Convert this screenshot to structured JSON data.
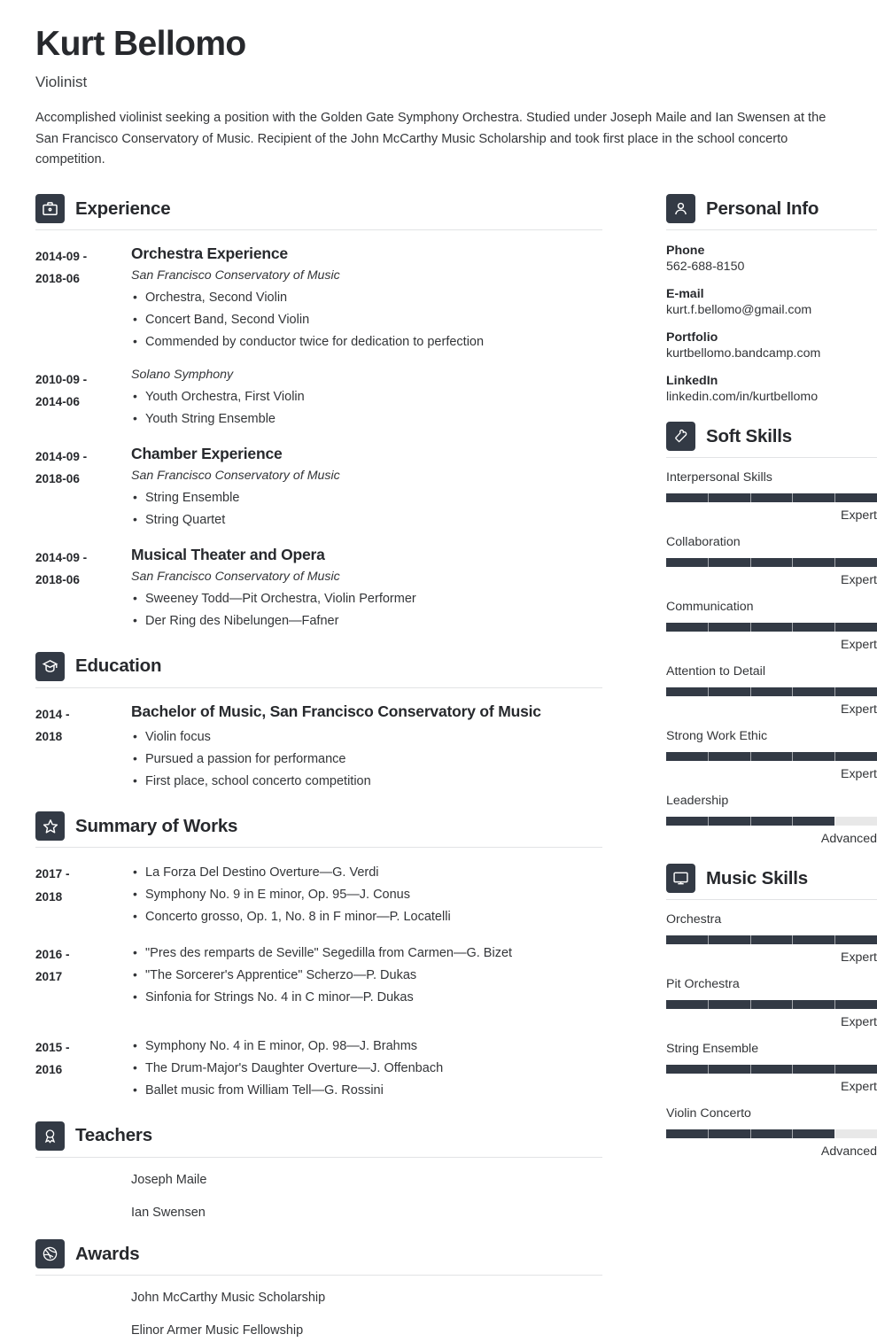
{
  "header": {
    "name": "Kurt Bellomo",
    "job_title": "Violinist",
    "summary": "Accomplished violinist seeking a position with the Golden Gate Symphony Orchestra. Studied under Joseph Maile and Ian Swensen at the San Francisco Conservatory of Music. Recipient of the John McCarthy Music Scholarship and took first place in the school concerto competition."
  },
  "theme": {
    "accent_dark": "#333a45",
    "text": "#333538",
    "heading": "#27292d",
    "rule": "#e2e3e5",
    "bar_track": "#e8e8e8"
  },
  "sections": {
    "experience": {
      "title": "Experience",
      "icon": "briefcase-icon",
      "entries": [
        {
          "date_from": "2014-09 -",
          "date_to": "2018-06",
          "title": "Orchestra Experience",
          "subtitle": "San Francisco Conservatory of Music",
          "bullets": [
            "Orchestra, Second Violin",
            "Concert Band, Second Violin",
            "Commended by conductor twice for dedication to perfection"
          ]
        },
        {
          "date_from": "2010-09 -",
          "date_to": "2014-06",
          "title": "",
          "subtitle": "Solano Symphony",
          "bullets": [
            "Youth Orchestra, First Violin",
            "Youth String Ensemble"
          ]
        },
        {
          "date_from": "2014-09 -",
          "date_to": "2018-06",
          "title": "Chamber Experience",
          "subtitle": "San Francisco Conservatory of Music",
          "bullets": [
            "String Ensemble",
            "String Quartet"
          ]
        },
        {
          "date_from": "2014-09 -",
          "date_to": "2018-06",
          "title": "Musical Theater and Opera",
          "subtitle": "San Francisco Conservatory of Music",
          "bullets": [
            "Sweeney Todd—Pit Orchestra, Violin Performer",
            "Der Ring des Nibelungen—Fafner"
          ]
        }
      ]
    },
    "education": {
      "title": "Education",
      "icon": "graduation-cap-icon",
      "entries": [
        {
          "date_from": "2014 -",
          "date_to": "2018",
          "title": "Bachelor of Music, San Francisco Conservatory of Music",
          "subtitle": "",
          "bullets": [
            "Violin focus",
            "Pursued a passion for performance",
            "First place, school concerto competition"
          ]
        }
      ]
    },
    "works": {
      "title": "Summary of Works",
      "icon": "star-icon",
      "entries": [
        {
          "date_from": "2017 -",
          "date_to": "2018",
          "bullets": [
            "La Forza Del Destino Overture—G. Verdi",
            "Symphony No. 9 in E minor, Op. 95—J. Conus",
            "Concerto grosso, Op. 1, No. 8 in F minor—P. Locatelli"
          ]
        },
        {
          "date_from": "2016 -",
          "date_to": "2017",
          "bullets": [
            "\"Pres des remparts de Seville\" Segedilla from Carmen—G. Bizet",
            "\"The Sorcerer's Apprentice\" Scherzo—P. Dukas",
            "Sinfonia for Strings No. 4 in C minor—P. Dukas"
          ]
        },
        {
          "date_from": "2015 -",
          "date_to": "2016",
          "bullets": [
            "Symphony No. 4 in E minor, Op. 98—J. Brahms",
            "The Drum-Major's Daughter Overture—J. Offenbach",
            "Ballet music from William Tell—G. Rossini"
          ]
        }
      ]
    },
    "teachers": {
      "title": "Teachers",
      "icon": "award-ribbon-icon",
      "items": [
        "Joseph Maile",
        "Ian Swensen"
      ]
    },
    "awards": {
      "title": "Awards",
      "icon": "dribbble-circle-icon",
      "items": [
        "John McCarthy Music Scholarship",
        "Elinor Armer Music Fellowship"
      ]
    },
    "personal_info": {
      "title": "Personal Info",
      "icon": "user-icon",
      "fields": [
        {
          "label": "Phone",
          "value": "562-688-8150"
        },
        {
          "label": "E-mail",
          "value": "kurt.f.bellomo@gmail.com"
        },
        {
          "label": "Portfolio",
          "value": "kurtbellomo.bandcamp.com"
        },
        {
          "label": "LinkedIn",
          "value": "linkedin.com/in/kurtbellomo"
        }
      ]
    },
    "soft_skills": {
      "title": "Soft Skills",
      "icon": "puzzle-heart-icon",
      "skills": [
        {
          "name": "Interpersonal Skills",
          "level": "Expert",
          "percent": 100
        },
        {
          "name": "Collaboration",
          "level": "Expert",
          "percent": 100
        },
        {
          "name": "Communication",
          "level": "Expert",
          "percent": 100
        },
        {
          "name": "Attention to Detail",
          "level": "Expert",
          "percent": 100
        },
        {
          "name": "Strong Work Ethic",
          "level": "Expert",
          "percent": 100
        },
        {
          "name": "Leadership",
          "level": "Advanced",
          "percent": 80
        }
      ]
    },
    "music_skills": {
      "title": "Music Skills",
      "icon": "monitor-icon",
      "skills": [
        {
          "name": "Orchestra",
          "level": "Expert",
          "percent": 100
        },
        {
          "name": "Pit Orchestra",
          "level": "Expert",
          "percent": 100
        },
        {
          "name": "String Ensemble",
          "level": "Expert",
          "percent": 100
        },
        {
          "name": "Violin Concerto",
          "level": "Advanced",
          "percent": 80
        }
      ]
    }
  }
}
